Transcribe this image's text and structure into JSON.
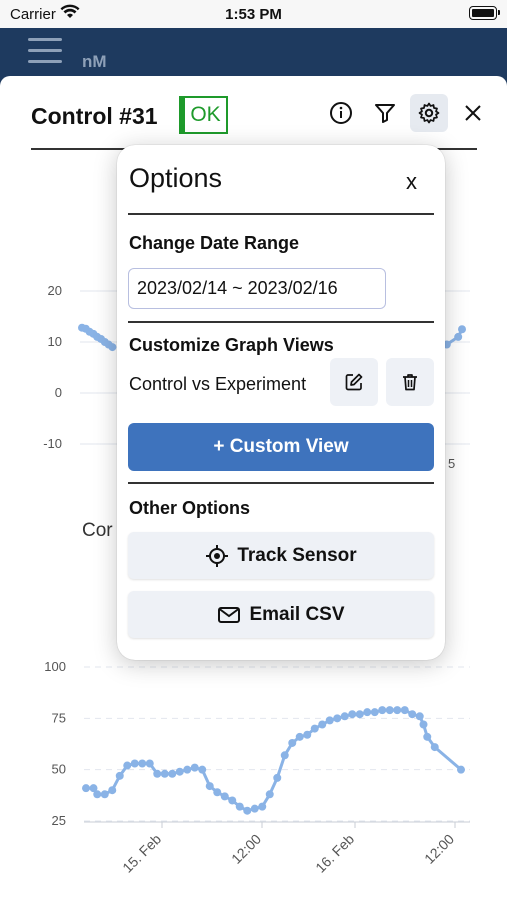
{
  "status_bar": {
    "carrier": "Carrier",
    "time": "1:53 PM"
  },
  "header": {
    "unit": "nM"
  },
  "sheet": {
    "title": "Control #31",
    "status_badge": "OK"
  },
  "chart_top": {
    "y_ticks": [
      "20",
      "10",
      "0",
      "-10"
    ],
    "right_fragment": "5"
  },
  "chart_bottom_title_fragment": "Cor",
  "chart_data": [
    {
      "type": "line",
      "title": "",
      "ylim": [
        -10,
        20
      ],
      "y_ticks": [
        20,
        10,
        0,
        -10
      ],
      "series": [
        {
          "x": [
            0,
            0.01,
            0.02,
            0.03,
            0.04,
            0.05,
            0.06,
            0.07,
            0.08
          ],
          "values": [
            12.8,
            12.6,
            12.0,
            11.6,
            11.0,
            10.6,
            10.0,
            9.5,
            9.0
          ]
        },
        {
          "x": [
            0.96,
            0.99,
            1.0
          ],
          "values": [
            9.5,
            11.0,
            12.5
          ]
        }
      ]
    },
    {
      "type": "line",
      "title": "",
      "ylim": [
        25,
        100
      ],
      "y_ticks": [
        100,
        75,
        50,
        25
      ],
      "x_ticks": [
        "15. Feb",
        "12:00",
        "16. Feb",
        "12:00"
      ],
      "series": [
        {
          "x": [
            0.0,
            0.02,
            0.03,
            0.05,
            0.07,
            0.09,
            0.11,
            0.13,
            0.15,
            0.17,
            0.19,
            0.21,
            0.23,
            0.25,
            0.27,
            0.29,
            0.31,
            0.33,
            0.35,
            0.37,
            0.39,
            0.41,
            0.43,
            0.45,
            0.47,
            0.49,
            0.51,
            0.53,
            0.55,
            0.57,
            0.59,
            0.61,
            0.63,
            0.65,
            0.67,
            0.69,
            0.71,
            0.73,
            0.75,
            0.77,
            0.79,
            0.81,
            0.83,
            0.85,
            0.87,
            0.89,
            0.9,
            0.91,
            0.93,
            1.0
          ],
          "values": [
            41,
            41,
            38,
            38,
            40,
            47,
            52,
            53,
            53,
            53,
            48,
            48,
            48,
            49,
            50,
            51,
            50,
            42,
            39,
            37,
            35,
            32,
            30,
            31,
            32,
            38,
            46,
            57,
            63,
            66,
            67,
            70,
            72,
            74,
            75,
            76,
            77,
            77,
            78,
            78,
            79,
            79,
            79,
            79,
            77,
            76,
            72,
            66,
            61,
            50
          ]
        }
      ]
    }
  ],
  "popover": {
    "title": "Options",
    "close_label": "x",
    "date_range_heading": "Change Date Range",
    "date_range_value": "2023/02/14 ~ 2023/02/16",
    "graph_views_heading": "Customize Graph Views",
    "view_name": "Control vs Experiment",
    "custom_view_button": "+ Custom View",
    "other_options_heading": "Other Options",
    "track_sensor_button": "Track Sensor",
    "email_csv_button": "Email CSV"
  }
}
